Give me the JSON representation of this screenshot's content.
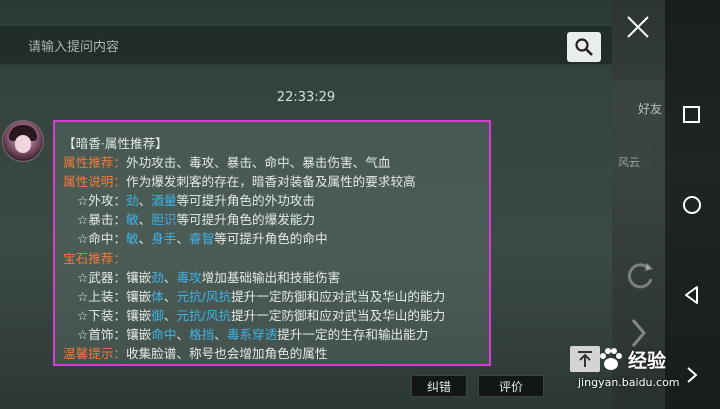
{
  "search": {
    "placeholder": "请输入提问内容"
  },
  "chat": {
    "time": "22:33:29",
    "lines": [
      {
        "parts": [
          {
            "t": "【暗香·属性推荐】",
            "c": "n"
          }
        ]
      },
      {
        "parts": [
          {
            "t": "属性推荐：",
            "c": "l"
          },
          {
            "t": "外功攻击、毒攻、暴击、命中、暴击伤害、气血",
            "c": "n"
          }
        ]
      },
      {
        "parts": [
          {
            "t": "属性说明：",
            "c": "l"
          },
          {
            "t": "作为爆发刺客的存在，暗香对装备及属性的要求较高",
            "c": "n"
          }
        ]
      },
      {
        "indent": true,
        "parts": [
          {
            "t": "☆外攻：",
            "c": "n"
          },
          {
            "t": "劲",
            "c": "h"
          },
          {
            "t": "、",
            "c": "n"
          },
          {
            "t": "酒量",
            "c": "h"
          },
          {
            "t": "等可提升角色的外功攻击",
            "c": "n"
          }
        ]
      },
      {
        "indent": true,
        "parts": [
          {
            "t": "☆暴击：",
            "c": "n"
          },
          {
            "t": "敏",
            "c": "h"
          },
          {
            "t": "、",
            "c": "n"
          },
          {
            "t": "胆识",
            "c": "h"
          },
          {
            "t": "等可提升角色的爆发能力",
            "c": "n"
          }
        ]
      },
      {
        "indent": true,
        "parts": [
          {
            "t": "☆命中：",
            "c": "n"
          },
          {
            "t": "敏",
            "c": "h"
          },
          {
            "t": "、",
            "c": "n"
          },
          {
            "t": "身手",
            "c": "h"
          },
          {
            "t": "、",
            "c": "n"
          },
          {
            "t": "睿智",
            "c": "h"
          },
          {
            "t": "等可提升角色的命中",
            "c": "n"
          }
        ]
      },
      {
        "parts": [
          {
            "t": "宝石推荐：",
            "c": "l"
          }
        ]
      },
      {
        "indent": true,
        "parts": [
          {
            "t": "☆武器：镶嵌",
            "c": "n"
          },
          {
            "t": "劲",
            "c": "h"
          },
          {
            "t": "、",
            "c": "n"
          },
          {
            "t": "毒攻",
            "c": "h"
          },
          {
            "t": "增加基础输出和技能伤害",
            "c": "n"
          }
        ]
      },
      {
        "indent": true,
        "parts": [
          {
            "t": "☆上装：镶嵌",
            "c": "n"
          },
          {
            "t": "体",
            "c": "h"
          },
          {
            "t": "、",
            "c": "n"
          },
          {
            "t": "元抗/风抗",
            "c": "h"
          },
          {
            "t": "提升一定防御和应对武当及华山的能力",
            "c": "n"
          }
        ]
      },
      {
        "indent": true,
        "parts": [
          {
            "t": "☆下装：镶嵌",
            "c": "n"
          },
          {
            "t": "御",
            "c": "h"
          },
          {
            "t": "、",
            "c": "n"
          },
          {
            "t": "元抗/风抗",
            "c": "h"
          },
          {
            "t": "提升一定防御和应对武当及华山的能力",
            "c": "n"
          }
        ]
      },
      {
        "indent": true,
        "parts": [
          {
            "t": "☆首饰：镶嵌",
            "c": "n"
          },
          {
            "t": "命中",
            "c": "h"
          },
          {
            "t": "、",
            "c": "n"
          },
          {
            "t": "格挡",
            "c": "h"
          },
          {
            "t": "、",
            "c": "n"
          },
          {
            "t": "毒系穿透",
            "c": "h"
          },
          {
            "t": "提升一定的生存和输出能力",
            "c": "n"
          }
        ]
      },
      {
        "parts": [
          {
            "t": "温馨提示：",
            "c": "l"
          },
          {
            "t": "收集脸谱、称号也会增加角色的属性",
            "c": "n"
          }
        ]
      }
    ],
    "buttons": {
      "correct": "纠错",
      "rate": "评价"
    }
  },
  "game_bg": {
    "text1": "好友",
    "text2": "风云"
  },
  "watermark": {
    "brand": "经验",
    "url": "jingyan.baidu.com"
  },
  "icons": [
    "close-icon",
    "search-icon",
    "square-icon",
    "circle-icon",
    "back-triangle-icon",
    "refresh-icon",
    "scroll-top-icon",
    "chevron-right-icon",
    "paw-icon"
  ],
  "colors": {
    "highlight_border": "#d63cd3",
    "label": "#f07a3c",
    "keyword": "#3fb2e8"
  }
}
